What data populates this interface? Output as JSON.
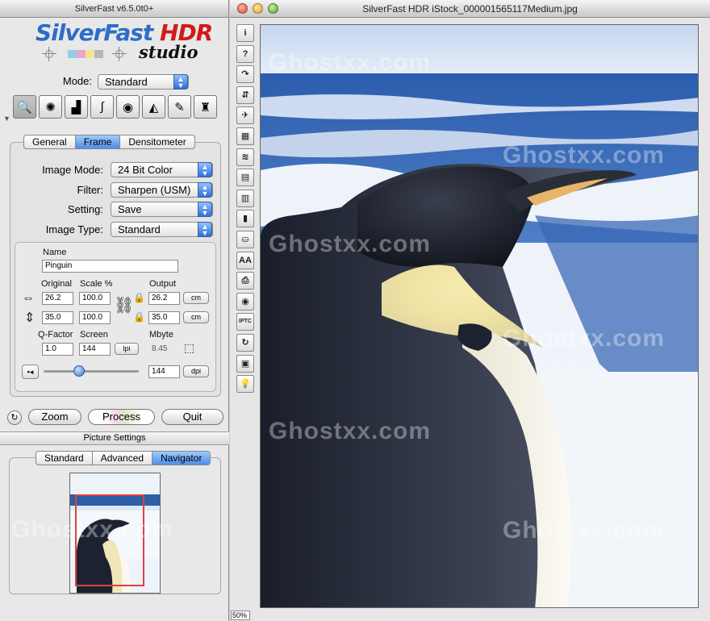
{
  "left_window": {
    "title": "SilverFast v6.5.0t0+",
    "logo": {
      "main_blue": "SilverFast",
      "main_red": "HDR",
      "sub": "studio"
    },
    "mode": {
      "label": "Mode:",
      "value": "Standard"
    },
    "tools": [
      {
        "name": "magnify-icon",
        "glyph": "🔍"
      },
      {
        "name": "aperture-icon",
        "glyph": "✺"
      },
      {
        "name": "histogram-icon",
        "glyph": "▟"
      },
      {
        "name": "curve-icon",
        "glyph": "∫"
      },
      {
        "name": "color-wheel-icon",
        "glyph": "◉"
      },
      {
        "name": "gradation-icon",
        "glyph": "◭"
      },
      {
        "name": "selective-color-icon",
        "glyph": "✎"
      },
      {
        "name": "expert-icon",
        "glyph": "♜"
      }
    ],
    "tabs": [
      "General",
      "Frame",
      "Densitometer"
    ],
    "active_tab": "Frame",
    "settings": [
      {
        "label": "Image Mode:",
        "value": "24 Bit Color"
      },
      {
        "label": "Filter:",
        "value": "Sharpen (USM)"
      },
      {
        "label": "Setting:",
        "value": "Save"
      },
      {
        "label": "Image Type:",
        "value": "Standard"
      }
    ],
    "frame": {
      "name_label": "Name",
      "name_value": "Pinguin",
      "col_original": "Original",
      "col_scale": "Scale %",
      "col_output": "Output",
      "width": {
        "original": "26.2",
        "scale": "100.0",
        "output": "26.2",
        "unit": "cm"
      },
      "height": {
        "original": "35.0",
        "scale": "100.0",
        "output": "35.0",
        "unit": "cm"
      },
      "qfactor_label": "Q-Factor",
      "qfactor_value": "1.0",
      "screen_label": "Screen",
      "screen_value": "144",
      "screen_unit": "lpi",
      "mbyte_label": "Mbyte",
      "mbyte_value": "8.45",
      "resolution_value": "144",
      "resolution_unit": "dpi",
      "slider_position": 0.37
    },
    "buttons": {
      "zoom": "Zoom",
      "process": "Process",
      "quit": "Quit"
    },
    "picture_settings": {
      "header": "Picture Settings",
      "tabs": [
        "Standard",
        "Advanced",
        "Navigator"
      ],
      "active_tab": "Navigator"
    }
  },
  "right_window": {
    "title": "SilverFast HDR iStock_000001565117Medium.jpg",
    "zoom": "50%",
    "side_tools": [
      {
        "name": "info-icon",
        "glyph": "i"
      },
      {
        "name": "help-icon",
        "glyph": "?"
      },
      {
        "name": "rotate-icon",
        "glyph": "↷"
      },
      {
        "name": "flip-icon",
        "glyph": "⇵"
      },
      {
        "name": "airplane-icon",
        "glyph": "✈"
      },
      {
        "name": "grain-icon",
        "glyph": "▦"
      },
      {
        "name": "dust-icon",
        "glyph": "≋"
      },
      {
        "name": "job-manager-icon",
        "glyph": "▤"
      },
      {
        "name": "batch-icon",
        "glyph": "▥"
      },
      {
        "name": "thumb-icon",
        "glyph": "▮"
      },
      {
        "name": "stamp-icon",
        "glyph": "⛀"
      },
      {
        "name": "aaca-icon",
        "glyph": "AA"
      },
      {
        "name": "print-icon",
        "glyph": "⎙"
      },
      {
        "name": "eye-icon",
        "glyph": "◉"
      },
      {
        "name": "iptc-icon",
        "glyph": "IPTC"
      },
      {
        "name": "refresh-icon",
        "glyph": "↻"
      },
      {
        "name": "film-icon",
        "glyph": "▣"
      },
      {
        "name": "lightbulb-icon",
        "glyph": "💡"
      }
    ],
    "watermark": "Ghostxx.com"
  },
  "colors": {
    "accent_blue": "#2f6fd8",
    "logo_red": "#d21a1a",
    "logo_blue": "#2e6cc6",
    "nav_frame": "#e04040"
  }
}
